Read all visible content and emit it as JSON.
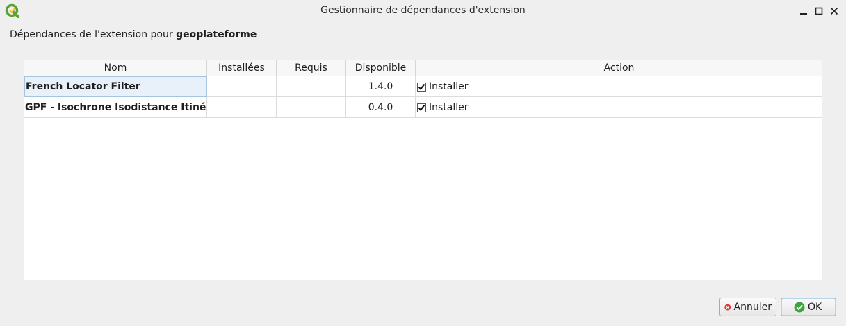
{
  "window": {
    "title": "Gestionnaire de dépendances d'extension"
  },
  "header": {
    "prefix": "Dépendances de l'extension pour ",
    "plugin_name": "geoplateforme"
  },
  "table": {
    "columns": [
      "Nom",
      "Installées",
      "Requis",
      "Disponible",
      "Action"
    ],
    "rows": [
      {
        "name": "French Locator Filter",
        "installed": "",
        "required": "",
        "available": "1.4.0",
        "action_label": "Installer",
        "action_checked": true
      },
      {
        "name": "GPF - Isochrone Isodistance Itinéraire",
        "installed": "",
        "required": "",
        "available": "0.4.0",
        "action_label": "Installer",
        "action_checked": true
      }
    ]
  },
  "buttons": {
    "cancel_label": "Annuler",
    "ok_label": "OK"
  },
  "colors": {
    "cancel_icon": "#d83a3a",
    "ok_icon": "#3aa53a",
    "app_icon": "#5aa333"
  }
}
